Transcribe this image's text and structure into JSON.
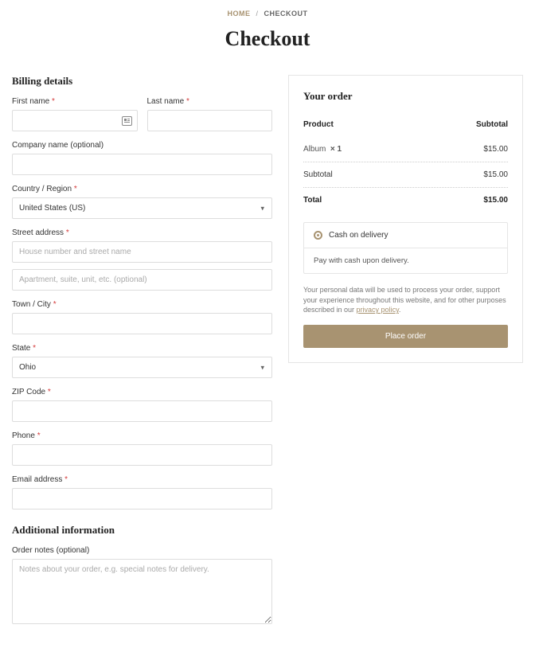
{
  "breadcrumb": {
    "home": "HOME",
    "current": "CHECKOUT"
  },
  "page_title": "Checkout",
  "billing": {
    "heading": "Billing details",
    "first_name": "First name",
    "last_name": "Last name",
    "company": "Company name (optional)",
    "country": "Country / Region",
    "country_value": "United States (US)",
    "street": "Street address",
    "street_ph1": "House number and street name",
    "street_ph2": "Apartment, suite, unit, etc. (optional)",
    "city": "Town / City",
    "state": "State",
    "state_value": "Ohio",
    "zip": "ZIP Code",
    "phone": "Phone",
    "email": "Email address"
  },
  "additional": {
    "heading": "Additional information",
    "notes": "Order notes (optional)",
    "notes_ph": "Notes about your order, e.g. special notes for delivery."
  },
  "order": {
    "heading": "Your order",
    "col_product": "Product",
    "col_subtotal": "Subtotal",
    "item_name": "Album",
    "item_qty": "× 1",
    "item_price": "$15.00",
    "subtotal_label": "Subtotal",
    "subtotal_value": "$15.00",
    "total_label": "Total",
    "total_value": "$15.00"
  },
  "payment": {
    "method": "Cash on delivery",
    "desc": "Pay with cash upon delivery."
  },
  "privacy": {
    "text": "Your personal data will be used to process your order, support your experience throughout this website, and for other purposes described in our ",
    "link": "privacy policy"
  },
  "place_order": "Place order"
}
